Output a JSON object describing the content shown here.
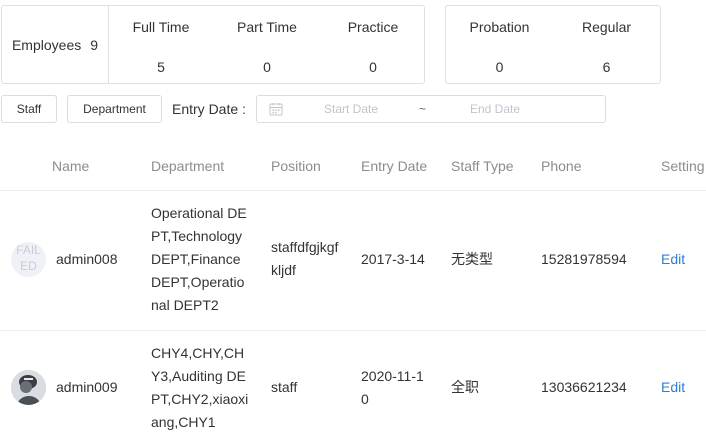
{
  "summary": {
    "employees_label": "Employees",
    "employees_count": "9",
    "full_time_label": "Full Time",
    "full_time_value": "5",
    "part_time_label": "Part Time",
    "part_time_value": "0",
    "practice_label": "Practice",
    "practice_value": "0",
    "probation_label": "Probation",
    "probation_value": "0",
    "regular_label": "Regular",
    "regular_value": "6"
  },
  "filters": {
    "staff_button": "Staff",
    "department_button": "Department",
    "entry_date_label": "Entry Date :",
    "start_placeholder": "Start Date",
    "separator": "~",
    "end_placeholder": "End Date"
  },
  "table": {
    "headers": [
      "Name",
      "Department",
      "Position",
      "Entry Date",
      "Staff Type",
      "Phone",
      "Setting"
    ],
    "rows": [
      {
        "avatar_text": "FAILED",
        "avatar_line1": "FAIL",
        "avatar_line2": "ED",
        "name": "admin008",
        "department_lines": [
          "Operational DE",
          "PT,Technology",
          "DEPT,Finance",
          "DEPT,Operatio",
          "nal DEPT2"
        ],
        "position_lines": [
          "staffdfgjkgf",
          "kljdf"
        ],
        "entry_date": "2017-3-14",
        "staff_type": "无类型",
        "phone": "15281978594",
        "setting": "Edit"
      },
      {
        "avatar_icon": "user-photo",
        "name": "admin009",
        "department_lines": [
          "CHY4,CHY,CH",
          "Y3,Auditing DE",
          "PT,CHY2,xiaoxi",
          "ang,CHY1"
        ],
        "position": "staff",
        "entry_date_lines": [
          "2020-11-1",
          "0"
        ],
        "staff_type": "全职",
        "phone": "13036621234",
        "setting": "Edit"
      }
    ]
  }
}
